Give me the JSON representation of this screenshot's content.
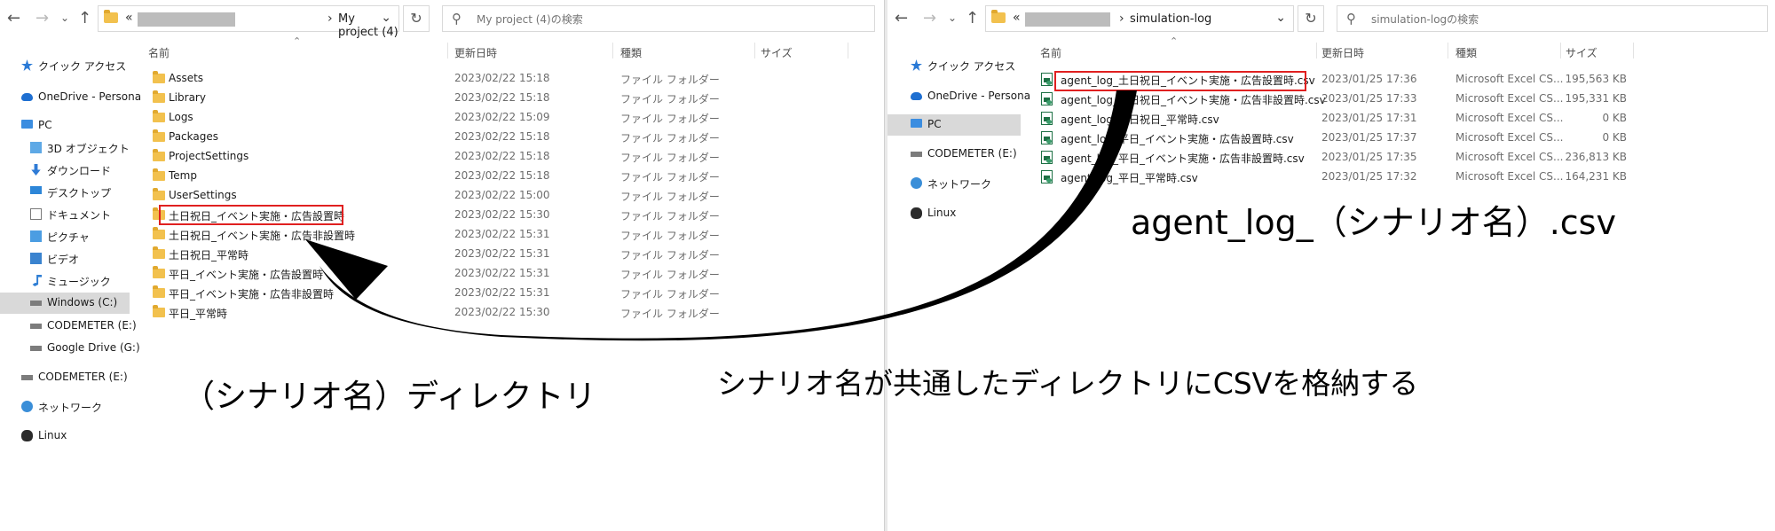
{
  "left": {
    "address": {
      "breadcrumb": "My project (4)"
    },
    "search": {
      "placeholder": "My project (4)の検索"
    },
    "nav": [
      {
        "label": "クイック アクセス",
        "icon": "star-icon"
      },
      {
        "label": "OneDrive - Persona",
        "icon": "cloud-icon"
      },
      {
        "label": "PC",
        "icon": "pc-icon"
      },
      {
        "label": "3D オブジェクト",
        "icon": "cube-icon"
      },
      {
        "label": "ダウンロード",
        "icon": "download-icon"
      },
      {
        "label": "デスクトップ",
        "icon": "desktop-icon"
      },
      {
        "label": "ドキュメント",
        "icon": "document-icon"
      },
      {
        "label": "ピクチャ",
        "icon": "picture-icon"
      },
      {
        "label": "ビデオ",
        "icon": "video-icon"
      },
      {
        "label": "ミュージック",
        "icon": "music-icon"
      },
      {
        "label": "Windows (C:)",
        "icon": "drive-icon"
      },
      {
        "label": "CODEMETER (E:)",
        "icon": "drive-icon"
      },
      {
        "label": "Google Drive (G:)",
        "icon": "drive-icon"
      },
      {
        "label": "CODEMETER (E:)",
        "icon": "drive-icon"
      },
      {
        "label": "ネットワーク",
        "icon": "network-icon"
      },
      {
        "label": "Linux",
        "icon": "linux-icon"
      }
    ],
    "columns": {
      "name": "名前",
      "date": "更新日時",
      "type": "種類",
      "size": "サイズ"
    },
    "files": [
      {
        "name": "Assets",
        "date": "2023/02/22 15:18",
        "type": "ファイル フォルダー"
      },
      {
        "name": "Library",
        "date": "2023/02/22 15:18",
        "type": "ファイル フォルダー"
      },
      {
        "name": "Logs",
        "date": "2023/02/22 15:09",
        "type": "ファイル フォルダー"
      },
      {
        "name": "Packages",
        "date": "2023/02/22 15:18",
        "type": "ファイル フォルダー"
      },
      {
        "name": "ProjectSettings",
        "date": "2023/02/22 15:18",
        "type": "ファイル フォルダー"
      },
      {
        "name": "Temp",
        "date": "2023/02/22 15:18",
        "type": "ファイル フォルダー"
      },
      {
        "name": "UserSettings",
        "date": "2023/02/22 15:00",
        "type": "ファイル フォルダー"
      },
      {
        "name": "土日祝日_イベント実施・広告設置時",
        "date": "2023/02/22 15:30",
        "type": "ファイル フォルダー"
      },
      {
        "name": "土日祝日_イベント実施・広告非設置時",
        "date": "2023/02/22 15:31",
        "type": "ファイル フォルダー"
      },
      {
        "name": "土日祝日_平常時",
        "date": "2023/02/22 15:31",
        "type": "ファイル フォルダー"
      },
      {
        "name": "平日_イベント実施・広告設置時",
        "date": "2023/02/22 15:31",
        "type": "ファイル フォルダー"
      },
      {
        "name": "平日_イベント実施・広告非設置時",
        "date": "2023/02/22 15:31",
        "type": "ファイル フォルダー"
      },
      {
        "name": "平日_平常時",
        "date": "2023/02/22 15:30",
        "type": "ファイル フォルダー"
      }
    ]
  },
  "right": {
    "address": {
      "breadcrumb": "simulation-log"
    },
    "search": {
      "placeholder": "simulation-logの検索"
    },
    "nav": [
      {
        "label": "クイック アクセス",
        "icon": "star-icon"
      },
      {
        "label": "OneDrive - Persona",
        "icon": "cloud-icon"
      },
      {
        "label": "PC",
        "icon": "pc-icon"
      },
      {
        "label": "CODEMETER (E:)",
        "icon": "drive-icon"
      },
      {
        "label": "ネットワーク",
        "icon": "network-icon"
      },
      {
        "label": "Linux",
        "icon": "linux-icon"
      }
    ],
    "columns": {
      "name": "名前",
      "date": "更新日時",
      "type": "種類",
      "size": "サイズ"
    },
    "files": [
      {
        "name": "agent_log_土日祝日_イベント実施・広告設置時.csv",
        "date": "2023/01/25 17:36",
        "type": "Microsoft Excel CS...",
        "size": "195,563 KB"
      },
      {
        "name": "agent_log_土日祝日_イベント実施・広告非設置時.csv",
        "date": "2023/01/25 17:33",
        "type": "Microsoft Excel CS...",
        "size": "195,331 KB"
      },
      {
        "name": "agent_log_土日祝日_平常時.csv",
        "date": "2023/01/25 17:31",
        "type": "Microsoft Excel CS...",
        "size": "0 KB"
      },
      {
        "name": "agent_log_平日_イベント実施・広告設置時.csv",
        "date": "2023/01/25 17:37",
        "type": "Microsoft Excel CS...",
        "size": "0 KB"
      },
      {
        "name": "agent_log_平日_イベント実施・広告非設置時.csv",
        "date": "2023/01/25 17:35",
        "type": "Microsoft Excel CS...",
        "size": "236,813 KB"
      },
      {
        "name": "agent_log_平日_平常時.csv",
        "date": "2023/01/25 17:32",
        "type": "Microsoft Excel CS...",
        "size": "164,231 KB"
      }
    ]
  },
  "annotations": {
    "csv_name_format": "agent_log_（シナリオ名）.csv",
    "directory_name": "（シナリオ名）ディレクトリ",
    "instruction": "シナリオ名が共通したディレクトリにCSVを格納する"
  },
  "colors": {
    "highlight_box": "#e02020",
    "selected_nav": "#d9d9d9",
    "folder": "#f2c14e",
    "csv_green": "#1e7145",
    "arrow": "#000000"
  }
}
